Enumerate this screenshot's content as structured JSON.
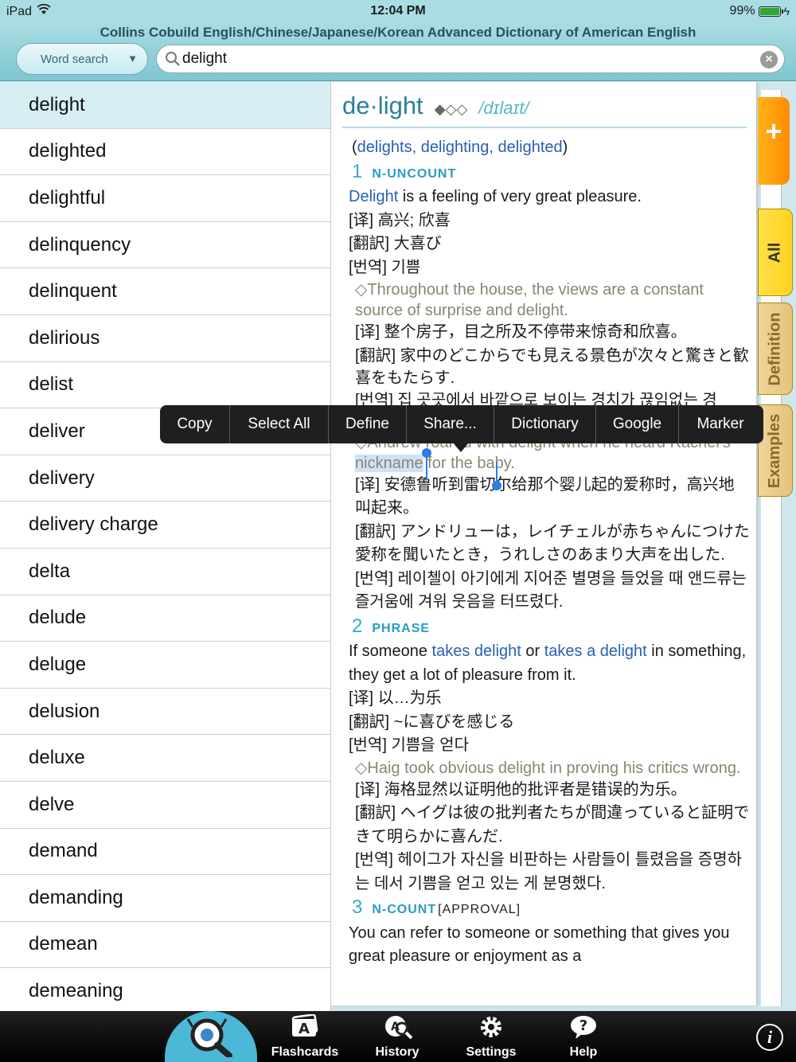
{
  "status_bar": {
    "device": "iPad",
    "time": "12:04 PM",
    "battery": "99%"
  },
  "header": {
    "app_title": "Collins Cobuild English/Chinese/Japanese/Korean Advanced Dictionary of American English",
    "search_mode": "Word search",
    "search_value": "delight"
  },
  "word_list": [
    "delight",
    "delighted",
    "delightful",
    "delinquency",
    "delinquent",
    "delirious",
    "delist",
    "deliver",
    "delivery",
    "delivery charge",
    "delta",
    "delude",
    "deluge",
    "delusion",
    "deluxe",
    "delve",
    "demand",
    "demanding",
    "demean",
    "demeaning"
  ],
  "entry": {
    "headword": "de·light",
    "frequency": "◆◇◇",
    "pronunciation": "/dɪlaɪt/",
    "forms_open": "(",
    "forms": "delights, delighting, delighted",
    "forms_close": ")",
    "sense1": {
      "num": "1",
      "pos": "N-UNCOUNT",
      "def_head": "Delight",
      "def_rest": " is a feeling of very great pleasure.",
      "zh": "[译] 高兴; 欣喜",
      "ja": "[翻訳] 大喜び",
      "ko": "[번역] 기쁨",
      "ex1": "◇Throughout the house, the views are a constant source of surprise and delight.",
      "ex1_zh": "[译] 整个房子，目之所及不停带来惊奇和欣喜。",
      "ex1_ja": "[翻訳] 家中のどこからでも見える景色が次々と驚きと歓喜をもたらす.",
      "ex1_ko_partial": "[번역] 집 곳곳에서 바깥으로 보이는 경치가 끊임없는 경",
      "ex2_pre": "◇Andrew roared with delight when he heard Rachel's ",
      "ex2_hl": "nickname",
      "ex2_post": " for the baby.",
      "ex2_zh": "[译] 安德鲁听到雷切尔给那个婴儿起的爱称时，高兴地叫起来。",
      "ex2_ja": "[翻訳] アンドリューは，レイチェルが赤ちゃんにつけた愛称を聞いたとき，うれしさのあまり大声を出した.",
      "ex2_ko": "[번역] 레이첼이 아기에게 지어준 별명을 들었을 때 앤드류는 즐거움에 겨워 웃음을 터뜨렸다."
    },
    "sense2": {
      "num": "2",
      "pos": "PHRASE",
      "def_a": "If someone ",
      "def_b": "takes delight",
      "def_c": " or ",
      "def_d": "takes a delight",
      "def_e": " in something, they get a lot of pleasure from it.",
      "zh": "[译] 以…为乐",
      "ja": "[翻訳] ~に喜びを感じる",
      "ko": "[번역] 기쁨을 얻다",
      "ex": "◇Haig took obvious delight in proving his critics wrong.",
      "ex_zh": "[译] 海格显然以证明他的批评者是错误的为乐。",
      "ex_ja": "[翻訳] ヘイグは彼の批判者たちが間違っていると証明できて明らかに喜んだ.",
      "ex_ko": "[번역] 헤이그가 자신을 비판하는 사람들이 틀렸음을 증명하는 데서 기쁨을 얻고 있는 게 분명했다."
    },
    "sense3": {
      "num": "3",
      "pos": "N-COUNT",
      "note": "[APPROVAL]",
      "def": "You can refer to someone or something that gives you great pleasure or enjoyment as a"
    }
  },
  "context_menu": [
    "Copy",
    "Select All",
    "Define",
    "Share...",
    "Dictionary",
    "Google",
    "Marker"
  ],
  "side_tabs": {
    "plus": "+",
    "all": "All",
    "definition": "Definition",
    "examples": "Examples"
  },
  "tab_bar": [
    "Flashcards",
    "History",
    "Settings",
    "Help"
  ],
  "info_label": "i",
  "colors": {
    "accent": "#4cb8d8",
    "tab_yellow": "#ffd21f",
    "tab_tan": "#e6c37a",
    "orange": "#ff9a00"
  }
}
